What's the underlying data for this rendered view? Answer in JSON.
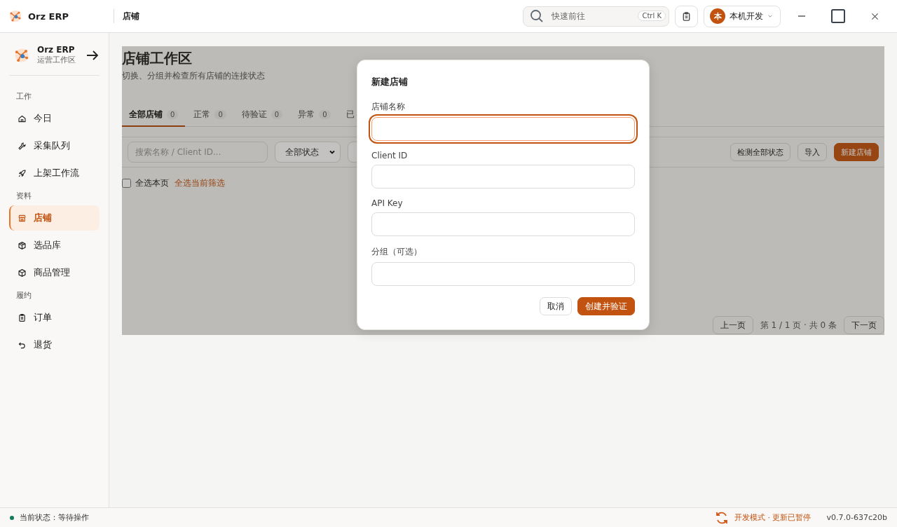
{
  "titlebar": {
    "app_name": "Orz ERP",
    "page": "店铺",
    "search": {
      "placeholder": "快速前往",
      "shortcut": "Ctrl K"
    },
    "user": {
      "avatar": "本",
      "name": "本机开发"
    }
  },
  "sidebar": {
    "brand": "Orz ERP",
    "workspace": "运营工作区",
    "sections": [
      {
        "title": "工作",
        "items": [
          {
            "label": "今日",
            "selected": false
          },
          {
            "label": "采集队列",
            "selected": false
          },
          {
            "label": "上架工作流",
            "selected": false
          }
        ]
      },
      {
        "title": "资料",
        "items": [
          {
            "label": "店铺",
            "selected": true
          },
          {
            "label": "选品库",
            "selected": false
          },
          {
            "label": "商品管理",
            "selected": false
          }
        ]
      },
      {
        "title": "履约",
        "items": [
          {
            "label": "订单",
            "selected": false
          },
          {
            "label": "退货",
            "selected": false
          }
        ]
      }
    ]
  },
  "page": {
    "title": "店铺工作区",
    "subtitle": "切换、分组并检查所有店铺的连接状态",
    "tabs": [
      {
        "label": "全部店铺",
        "count": "0",
        "selected": true
      },
      {
        "label": "正常",
        "count": "0",
        "selected": false
      },
      {
        "label": "待验证",
        "count": "0",
        "selected": false
      },
      {
        "label": "异常",
        "count": "0",
        "selected": false
      },
      {
        "label": "已",
        "selected": false
      }
    ],
    "search": {
      "placeholder": "搜索名称 / Client ID..."
    },
    "status_filter": {
      "value": "全部状态"
    },
    "actions": [
      {
        "label": "检测全部状态",
        "primary": false
      },
      {
        "label": "导入",
        "primary": false
      },
      {
        "label": "新建店铺",
        "primary": true
      }
    ],
    "select_page": {
      "label": "全选本页",
      "checked": false
    },
    "select_filtered_link": "全选当前筛选",
    "pagination": {
      "prev": "上一页",
      "info": "第 1 / 1 页 · 共 0 条",
      "next": "下一页"
    }
  },
  "dialog": {
    "title": "新建店铺",
    "fields": [
      {
        "label": "店铺名称",
        "focused": true
      },
      {
        "label": "Client ID",
        "focused": false
      },
      {
        "label": "API Key",
        "focused": false
      },
      {
        "label": "分组（可选）",
        "focused": false
      }
    ],
    "buttons": [
      {
        "label": "取消",
        "primary": false
      },
      {
        "label": "创建并验证",
        "primary": true
      }
    ]
  },
  "status_bar": {
    "status": "当前状态：等待操作",
    "mode": "开发模式 · 更新已暂停",
    "version": "v0.7.0-637c20b"
  }
}
